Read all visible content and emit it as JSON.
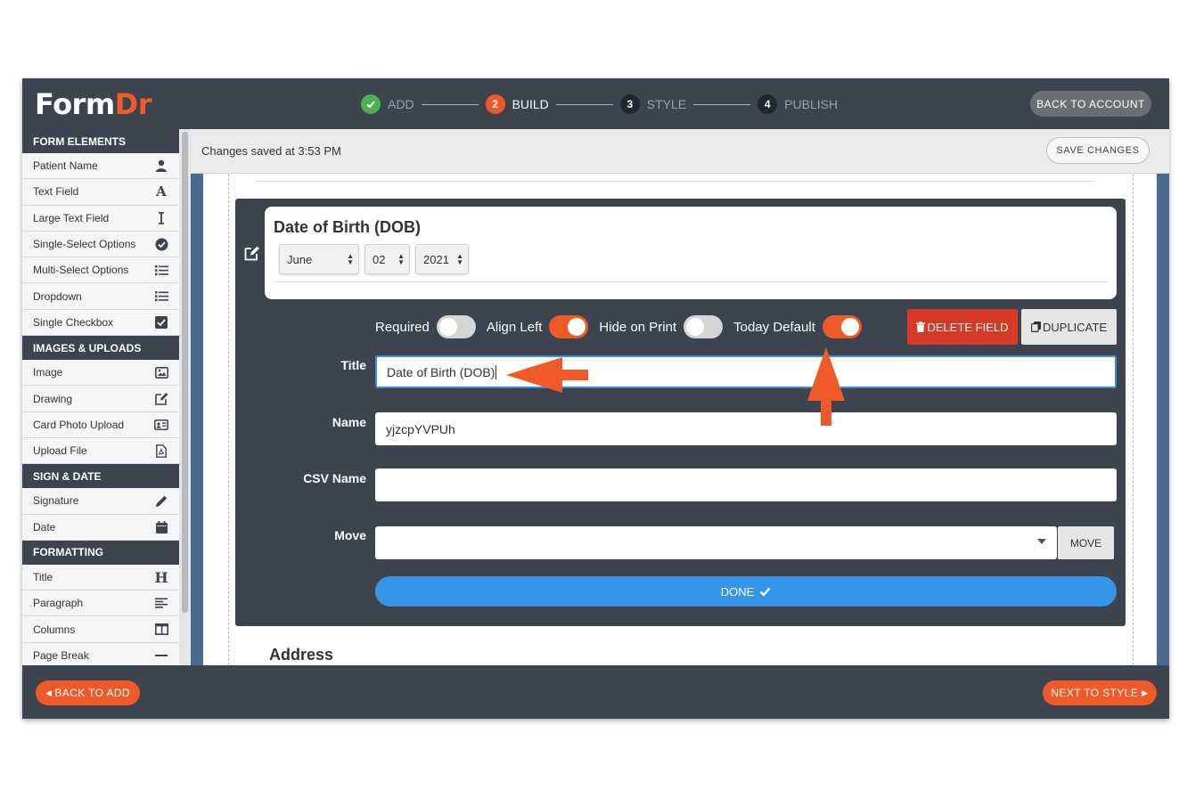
{
  "brand": {
    "part1": "Form",
    "part2": "Dr"
  },
  "steps": [
    {
      "num": "✓",
      "label": "ADD",
      "state": "done"
    },
    {
      "num": "2",
      "label": "BUILD",
      "state": "current"
    },
    {
      "num": "3",
      "label": "STYLE",
      "state": "pending"
    },
    {
      "num": "4",
      "label": "PUBLISH",
      "state": "pending"
    }
  ],
  "header": {
    "back_to_account": "BACK TO ACCOUNT"
  },
  "sidebar": {
    "sections": [
      {
        "title": "FORM ELEMENTS",
        "items": [
          {
            "label": "Patient Name",
            "icon": "user-icon"
          },
          {
            "label": "Text Field",
            "icon": "letter-a-icon"
          },
          {
            "label": "Large Text Field",
            "icon": "text-cursor-icon"
          },
          {
            "label": "Single-Select Options",
            "icon": "check-circle-icon"
          },
          {
            "label": "Multi-Select Options",
            "icon": "list-icon"
          },
          {
            "label": "Dropdown",
            "icon": "list-icon"
          },
          {
            "label": "Single Checkbox",
            "icon": "checkbox-icon"
          }
        ]
      },
      {
        "title": "IMAGES & UPLOADS",
        "items": [
          {
            "label": "Image",
            "icon": "image-icon"
          },
          {
            "label": "Drawing",
            "icon": "edit-icon"
          },
          {
            "label": "Card Photo Upload",
            "icon": "id-card-icon"
          },
          {
            "label": "Upload File",
            "icon": "file-pdf-icon"
          }
        ]
      },
      {
        "title": "SIGN & DATE",
        "items": [
          {
            "label": "Signature",
            "icon": "pen-icon"
          },
          {
            "label": "Date",
            "icon": "calendar-icon"
          }
        ]
      },
      {
        "title": "FORMATTING",
        "items": [
          {
            "label": "Title",
            "icon": "heading-icon"
          },
          {
            "label": "Paragraph",
            "icon": "align-left-icon"
          },
          {
            "label": "Columns",
            "icon": "columns-icon"
          },
          {
            "label": "Page Break",
            "icon": "page-break-icon"
          }
        ]
      }
    ]
  },
  "savebar": {
    "status": "Changes saved at 3:53 PM",
    "save_label": "SAVE CHANGES"
  },
  "field_preview": {
    "title": "Date of Birth (DOB)",
    "month": "June",
    "day": "02",
    "year": "2021"
  },
  "toggles": [
    {
      "label": "Required",
      "on": false
    },
    {
      "label": "Align Left",
      "on": true
    },
    {
      "label": "Hide on Print",
      "on": false
    },
    {
      "label": "Today Default",
      "on": true
    }
  ],
  "actions": {
    "delete": "DELETE FIELD",
    "duplicate": "DUPLICATE",
    "move": "MOVE",
    "done": "DONE"
  },
  "fields": {
    "title": {
      "label": "Title",
      "value": "Date of Birth (DOB)"
    },
    "name": {
      "label": "Name",
      "value": "yjzcpYVPUh"
    },
    "csv": {
      "label": "CSV Name",
      "value": ""
    },
    "move": {
      "label": "Move",
      "value": ""
    }
  },
  "next_field": {
    "title": "Address"
  },
  "footer": {
    "back": "BACK TO ADD",
    "next": "NEXT TO STYLE"
  },
  "colors": {
    "accent": "#f05a28",
    "dark": "#3d4450",
    "blue": "#3596e8",
    "danger": "#d63a26"
  }
}
